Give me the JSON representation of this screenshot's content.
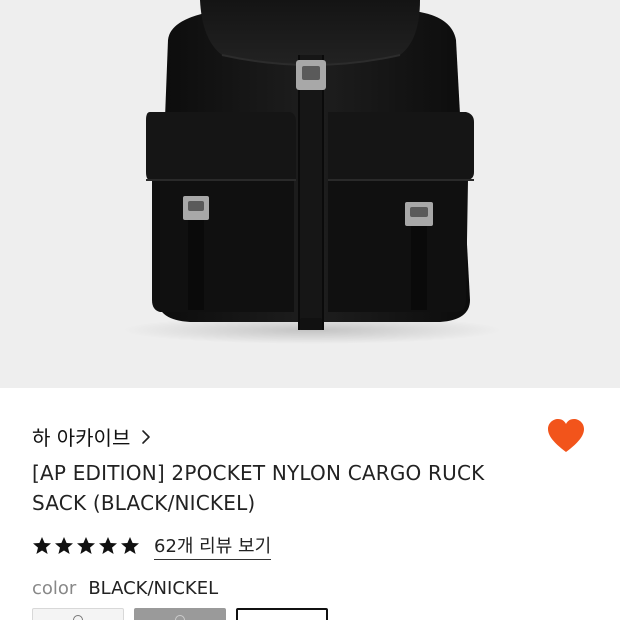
{
  "product": {
    "brand": "하 아카이브",
    "title": "[AP EDITION] 2POCKET NYLON CARGO RUCK SACK (BLACK/NICKEL)",
    "wishlisted": true,
    "rating": 5,
    "review_link": "62개 리뷰 보기",
    "color_label": "color",
    "color_value": "BLACK/NICKEL"
  },
  "icons": {
    "brand_chevron": "chevron-right-icon",
    "wishlist": "heart-icon",
    "star": "star-icon"
  },
  "colors": {
    "heart": "#f2541b",
    "star": "#111111",
    "hero_background": "#eeeeee"
  }
}
